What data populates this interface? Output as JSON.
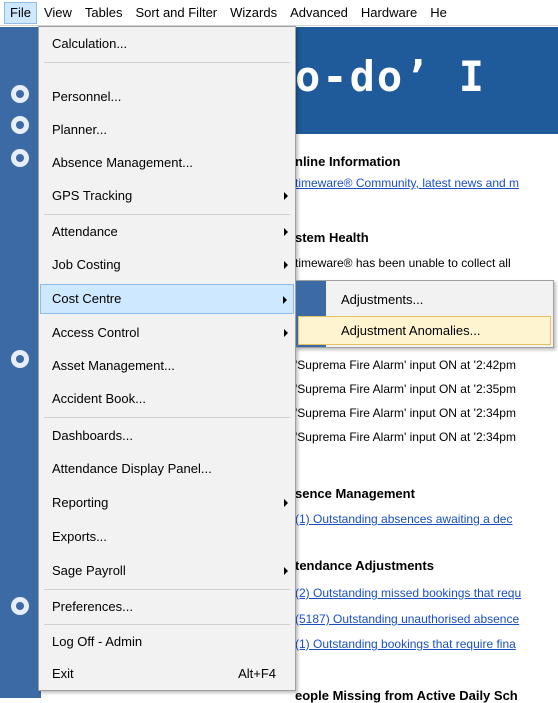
{
  "menubar": {
    "items": [
      {
        "label": "File"
      },
      {
        "label": "View"
      },
      {
        "label": "Tables"
      },
      {
        "label": "Sort and Filter"
      },
      {
        "label": "Wizards"
      },
      {
        "label": "Advanced"
      },
      {
        "label": "Hardware"
      },
      {
        "label": "He"
      }
    ]
  },
  "banner": {
    "text": "o-do’ I"
  },
  "content": {
    "online_info": {
      "heading": "nline Information",
      "link": "timeware® Community, latest news and m"
    },
    "system_health": {
      "heading": "stem Health",
      "text": "timeware® has been unable to collect all",
      "alarms": [
        "'Suprema Fire Alarm' input ON at '2:42pm",
        "'Suprema Fire Alarm' input ON at '2:35pm",
        "'Suprema Fire Alarm' input ON at '2:34pm",
        "'Suprema Fire Alarm' input ON at '2:34pm"
      ]
    },
    "absence": {
      "heading": "sence Management",
      "link": "(1) Outstanding absences awaiting a dec"
    },
    "attendance_adj": {
      "heading": "tendance Adjustments",
      "links": [
        "(2) Outstanding missed bookings that requ",
        "(5187) Outstanding unauthorised absence",
        "(1) Outstanding bookings that require fina"
      ]
    },
    "people_missing": {
      "heading": "eople Missing from Active Daily Sch"
    }
  },
  "file_menu": {
    "items": [
      {
        "label": "Calculation..."
      },
      {
        "label": "Personnel..."
      },
      {
        "label": "Planner..."
      },
      {
        "label": "Absence Management..."
      },
      {
        "label": "GPS Tracking"
      },
      {
        "label": "Attendance"
      },
      {
        "label": "Job Costing"
      },
      {
        "label": "Cost Centre"
      },
      {
        "label": "Access Control"
      },
      {
        "label": "Asset Management..."
      },
      {
        "label": "Accident Book..."
      },
      {
        "label": "Dashboards..."
      },
      {
        "label": "Attendance Display Panel..."
      },
      {
        "label": "Reporting"
      },
      {
        "label": "Exports..."
      },
      {
        "label": "Sage Payroll"
      },
      {
        "label": "Preferences..."
      },
      {
        "label": "Log Off - Admin"
      },
      {
        "label": "Exit",
        "shortcut": "Alt+F4"
      }
    ]
  },
  "cost_centre_submenu": {
    "items": [
      {
        "label": "Adjustments..."
      },
      {
        "label": "Adjustment Anomalies..."
      }
    ]
  },
  "colors": {
    "accent": "#3b6aa5",
    "highlight": "#cde8ff",
    "submenu_highlight": "#fff4d0",
    "link": "#1a4fc4"
  }
}
